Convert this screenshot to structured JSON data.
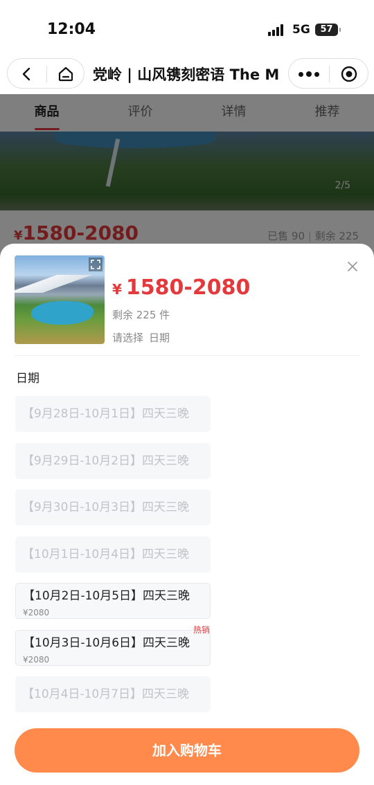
{
  "status_bar": {
    "time": "12:04",
    "network": "5G",
    "battery": "57"
  },
  "nav": {
    "title": "党岭 | 山风镌刻密语 The M"
  },
  "tabs": [
    {
      "label": "商品",
      "active": true
    },
    {
      "label": "评价",
      "active": false
    },
    {
      "label": "详情",
      "active": false
    },
    {
      "label": "推荐",
      "active": false
    }
  ],
  "product": {
    "image_pager": "2/5",
    "currency": "¥",
    "price_range": "1580-2080",
    "sold": "已售 90",
    "remaining_stat": "剩余 225"
  },
  "sheet": {
    "currency": "¥",
    "price_range": "1580-2080",
    "stock": "剩余 225 件",
    "select_prompt": "请选择",
    "select_spec": "日期",
    "section_title": "日期",
    "options": [
      {
        "label": "【9月28日-10月1日】四天三晚",
        "price": "",
        "available": false,
        "badge": ""
      },
      {
        "label": "【9月29日-10月2日】四天三晚",
        "price": "",
        "available": false,
        "badge": ""
      },
      {
        "label": "【9月30日-10月3日】四天三晚",
        "price": "",
        "available": false,
        "badge": ""
      },
      {
        "label": "【10月1日-10月4日】四天三晚",
        "price": "",
        "available": false,
        "badge": ""
      },
      {
        "label": "【10月2日-10月5日】四天三晚",
        "price": "¥2080",
        "available": true,
        "badge": ""
      },
      {
        "label": "【10月3日-10月6日】四天三晚",
        "price": "¥2080",
        "available": true,
        "badge": "热销"
      },
      {
        "label": "【10月4日-10月7日】四天三晚",
        "price": "",
        "available": false,
        "badge": ""
      }
    ],
    "add_to_cart": "加入购物车"
  },
  "colors": {
    "accent": "#e4393c",
    "button": "#ff8a4c",
    "disabled_text": "#c0c3c8"
  },
  "icons": [
    "back-icon",
    "home-icon",
    "more-dots-icon",
    "target-icon",
    "expand-icon",
    "close-icon"
  ]
}
